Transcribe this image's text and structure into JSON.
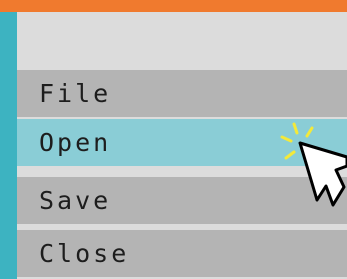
{
  "menu": {
    "items": [
      {
        "label": "File"
      },
      {
        "label": "Open"
      },
      {
        "label": "Save"
      },
      {
        "label": "Close"
      }
    ],
    "selected_index": 1
  },
  "colors": {
    "top_bar": "#f07a2e",
    "sidebar": "#3db3c1",
    "panel_background": "#dcdcdc",
    "item_background": "#b4b4b4",
    "item_selected_background": "#8acdd6",
    "click_spark": "#f3e93a"
  },
  "icons": {
    "cursor": "mouse-pointer-icon",
    "click_effect": "click-spark-icon"
  }
}
